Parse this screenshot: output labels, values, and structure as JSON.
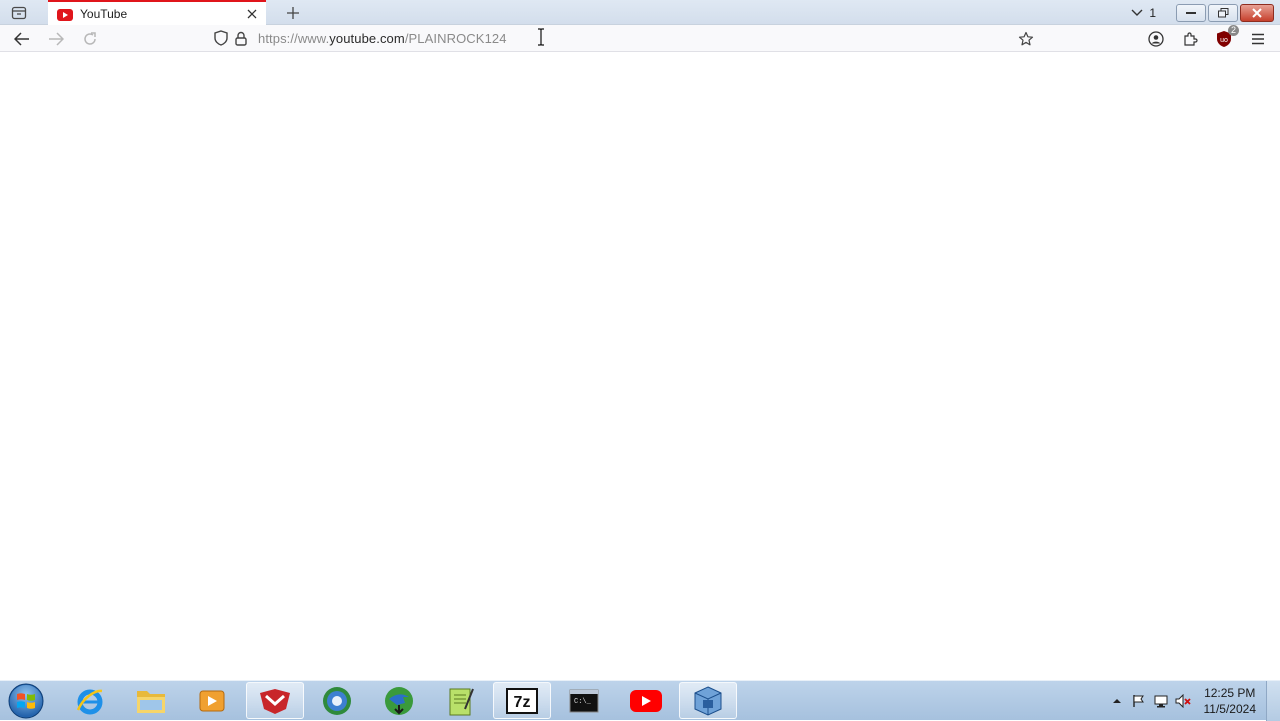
{
  "browser": {
    "tabs": [
      {
        "title": "YouTube",
        "active": true,
        "favicon": "youtube-icon"
      }
    ],
    "tab_overflow_count": "1",
    "url": {
      "scheme": "https://www.",
      "host": "youtube.com",
      "path": "/PLAINROCK124"
    },
    "extension_badge": "2"
  },
  "taskbar": {
    "apps": [
      {
        "name": "internet-explorer-icon",
        "active": false
      },
      {
        "name": "file-explorer-icon",
        "active": false
      },
      {
        "name": "media-player-icon",
        "active": false
      },
      {
        "name": "app-red-icon",
        "active": true
      },
      {
        "name": "globe-app-icon",
        "active": false
      },
      {
        "name": "download-manager-icon",
        "active": false
      },
      {
        "name": "notepad-icon",
        "active": false
      },
      {
        "name": "7zip-icon",
        "active": true
      },
      {
        "name": "command-prompt-icon",
        "active": false
      },
      {
        "name": "youtube-icon",
        "active": false
      },
      {
        "name": "virtualbox-icon",
        "active": true
      }
    ],
    "clock": {
      "time": "12:25 PM",
      "date": "11/5/2024"
    }
  },
  "colors": {
    "accent": "#e0151b",
    "youtube_red": "#ff0000"
  }
}
